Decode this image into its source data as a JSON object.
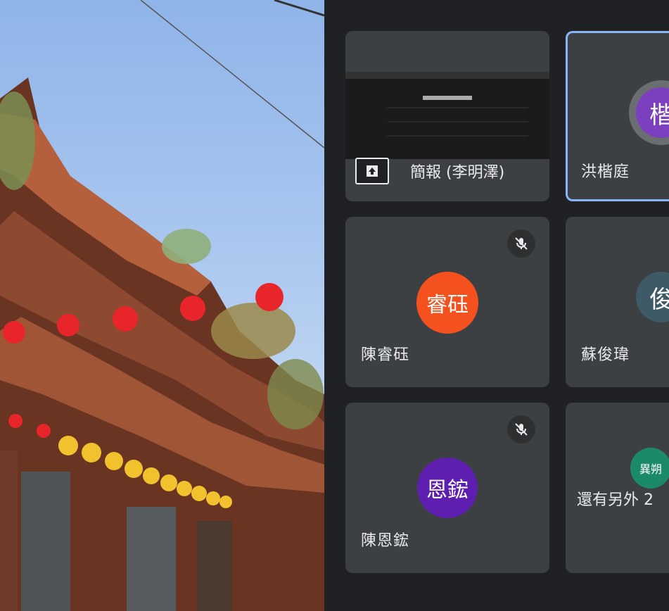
{
  "tiles": {
    "presentation": {
      "label": "簡報 (李明澤)"
    },
    "t2": {
      "name": "洪楷庭",
      "avatar": "楷",
      "color": "#7b3fbf"
    },
    "t3": {
      "name": "陳睿砡",
      "avatar": "睿砡",
      "color": "#f4511e"
    },
    "t4": {
      "name": "蘇俊瑋",
      "avatar": "俊",
      "color": "#3d5a66"
    },
    "t5": {
      "name": "陳恩鋐",
      "avatar": "恩鋐",
      "color": "#5e1fb0"
    },
    "t6": {
      "more": "還有另外 2",
      "avatar": "異朔",
      "color": "#1b8a6b"
    }
  },
  "colors": {
    "tile_bg": "#3c4043",
    "page_bg": "#202124",
    "active_border": "#8ab4f8"
  },
  "icons": [
    "present-icon",
    "mic-off-icon"
  ]
}
